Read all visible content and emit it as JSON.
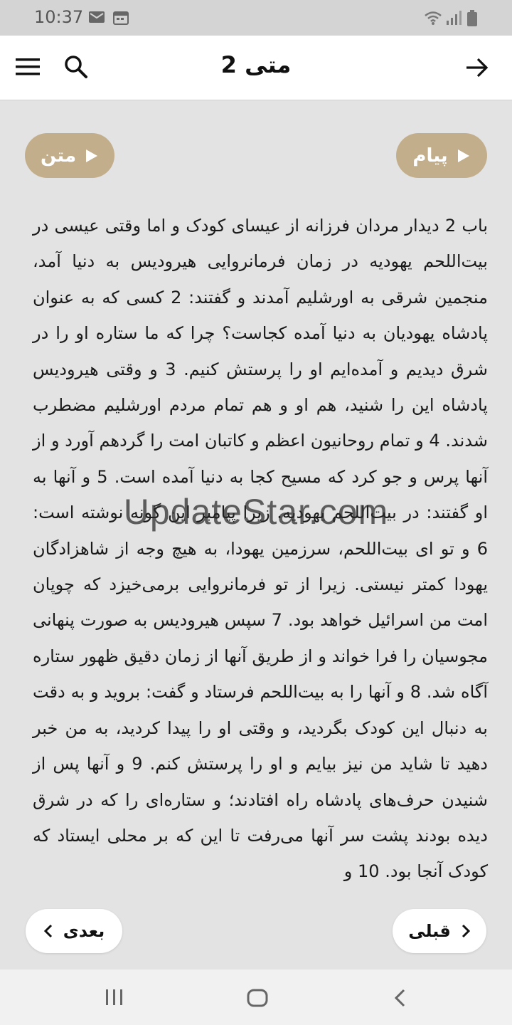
{
  "status_bar": {
    "time": "10:37",
    "icons": [
      "gmail-icon",
      "calendar-icon",
      "wifi-icon",
      "signal-icon",
      "battery-icon"
    ]
  },
  "app_bar": {
    "title": "متی 2",
    "icons": [
      "menu-icon",
      "search-icon",
      "back-arrow-icon"
    ]
  },
  "buttons": {
    "audio_label": "پیام",
    "text_label": "متن"
  },
  "content": {
    "text": "باب 2 دیدار مردان فرزانه از عیسای کودک و اما وقتی عیسی در بیت‌اللحم یهودیه در زمان فرمانروایی هیرودیس به دنیا آمد، منجمین شرقی به اورشلیم آمدند و گفتند: 2 کسی که به عنوان پادشاه یهودیان به دنیا آمده کجاست؟ چرا که ما ستاره او را در شرق دیدیم و آمده‌ایم او را پرستش کنیم. 3 و وقتی هیرودیس پادشاه این را شنید، هم او و هم تمام مردم اورشلیم مضطرب شدند. 4 و تمام روحانیون اعظم و کاتبان امت را گردهم آورد و از آنها پرس و جو کرد که مسیح کجا به دنیا آمده است. 5 و آنها به او گفتند: در بیت‌اللحم یهودیه. زیرا پیامبر این گونه نوشته است: 6 و تو ای بیت‌اللحم، سرزمین یهودا، به هیچ وجه از شاهزادگان یهودا کمتر نیستی. زیرا از تو فرمانروایی برمی‌خیزد که چوپان امت من اسرائیل خواهد بود. 7 سپس هیرودیس به صورت پنهانی مجوسیان را فرا خواند و از طریق آنها از زمان دقیق ظهور ستاره آگاه شد. 8 و آنها را به بیت‌اللحم فرستاد و گفت: بروید و به دقت به دنبال این کودک بگردید، و وقتی او را پیدا کردید، به من خبر دهید تا شاید من نیز بیایم و او را پرستش کنم. 9 و آنها پس از شنیدن حرف‌های پادشاه راه افتادند؛ و ستاره‌ای را که در شرق دیده بودند پشت سر آنها می‌رفت تا این که بر محلی ایستاد که کودک آنجا بود. 10 و"
  },
  "watermark": "UpdateStar.com",
  "nav": {
    "next_label": "بعدی",
    "prev_label": "قبلی"
  },
  "system_nav": {
    "icons": [
      "recent-apps-icon",
      "home-icon",
      "system-back-icon"
    ]
  },
  "colors": {
    "accent_pill": "#c3ae8c",
    "background": "#e3e3e3",
    "app_bar": "#ffffff"
  }
}
